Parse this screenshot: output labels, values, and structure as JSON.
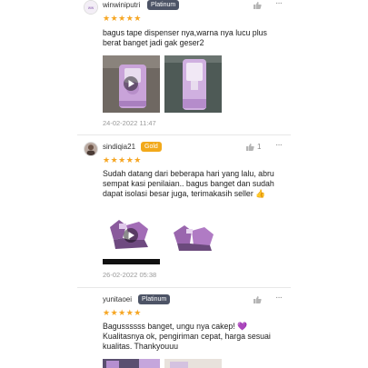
{
  "reviews": [
    {
      "username": "winwiniputri",
      "badge": "Platinum",
      "stars": "★★★★★",
      "text": "bagus tape dispenser nya,warna nya lucu plus berat banget jadi gak geser2",
      "date": "24-02-2022 11:47",
      "more": "···"
    },
    {
      "username": "sindiqia21",
      "badge": "Gold",
      "like_count": "1",
      "stars": "★★★★★",
      "text": "Sudah datang dari beberapa hari yang lalu, abru sempat kasi penilaian.. bagus banget dan sudah dapat isolasi besar juga, terimakasih seller 👍",
      "date": "26-02-2022 05:38",
      "more": "···"
    },
    {
      "username": "yunitaoei",
      "badge": "Platinum",
      "stars": "★★★★★",
      "text": "Bagussssss banget, ungu nya cakep! 💜 Kualitasnya ok, pengiriman cepat, harga sesuai kualitas. Thankyouuu",
      "more": "···"
    }
  ],
  "colors": {
    "star": "#f6a623",
    "platinum_badge": "#4d5466",
    "gold_badge": "#f2a91b",
    "product_purple": "#c9a3d9"
  },
  "icons": [
    "like-icon",
    "more-icon",
    "play-icon",
    "avatar"
  ]
}
